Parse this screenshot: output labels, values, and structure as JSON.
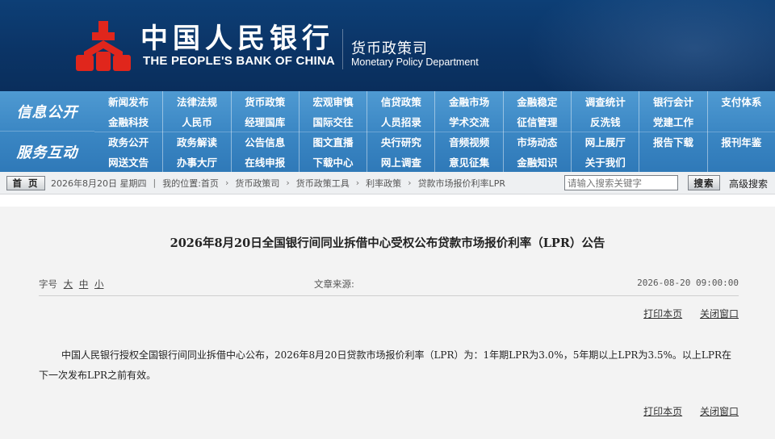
{
  "header": {
    "bank_name_cn": "中国人民银行",
    "bank_name_en": "THE PEOPLE'S BANK OF CHINA",
    "dept_name_cn": "货币政策司",
    "dept_name_en": "Monetary Policy Department",
    "brand_color": "#0b3466",
    "logo_color": "#e0261c"
  },
  "nav": {
    "section1": "信息公开",
    "section2": "服务互动",
    "row1": [
      "新闻发布",
      "法律法规",
      "货币政策",
      "宏观审慎",
      "信贷政策",
      "金融市场",
      "金融稳定",
      "调查统计",
      "银行会计",
      "支付体系"
    ],
    "row2": [
      "金融科技",
      "人民币",
      "经理国库",
      "国际交往",
      "人员招录",
      "学术交流",
      "征信管理",
      "反洗钱",
      "党建工作",
      ""
    ],
    "row3": [
      "政务公开",
      "政务解读",
      "公告信息",
      "图文直播",
      "央行研究",
      "音频视频",
      "市场动态",
      "网上展厅",
      "报告下载",
      "报刊年鉴"
    ],
    "row4": [
      "网送文告",
      "办事大厅",
      "在线申报",
      "下载中心",
      "网上调查",
      "意见征集",
      "金融知识",
      "关于我们",
      "",
      ""
    ]
  },
  "crumbs": {
    "home": "首 页",
    "date": "2026年8月20日 星期四",
    "location_label": "我的位置:首页",
    "path": [
      "货币政策司",
      "货币政策工具",
      "利率政策",
      "贷款市场报价利率LPR"
    ],
    "search_placeholder": "请输入搜索关键字",
    "search_button": "搜索",
    "advanced_search": "高级搜索"
  },
  "article": {
    "title": "2026年8月20日全国银行间同业拆借中心受权公布贷款市场报价利率（LPR）公告",
    "font_label": "字号",
    "font_large": "大",
    "font_medium": "中",
    "font_small": "小",
    "source_label": "文章来源:",
    "datetime": "2026-08-20 09:00:00",
    "print": "打印本页",
    "close": "关闭窗口",
    "body": "中国人民银行授权全国银行间同业拆借中心公布，2026年8月20日贷款市场报价利率（LPR）为：1年期LPR为3.0%，5年期以上LPR为3.5%。以上LPR在下一次发布LPR之前有效。"
  }
}
